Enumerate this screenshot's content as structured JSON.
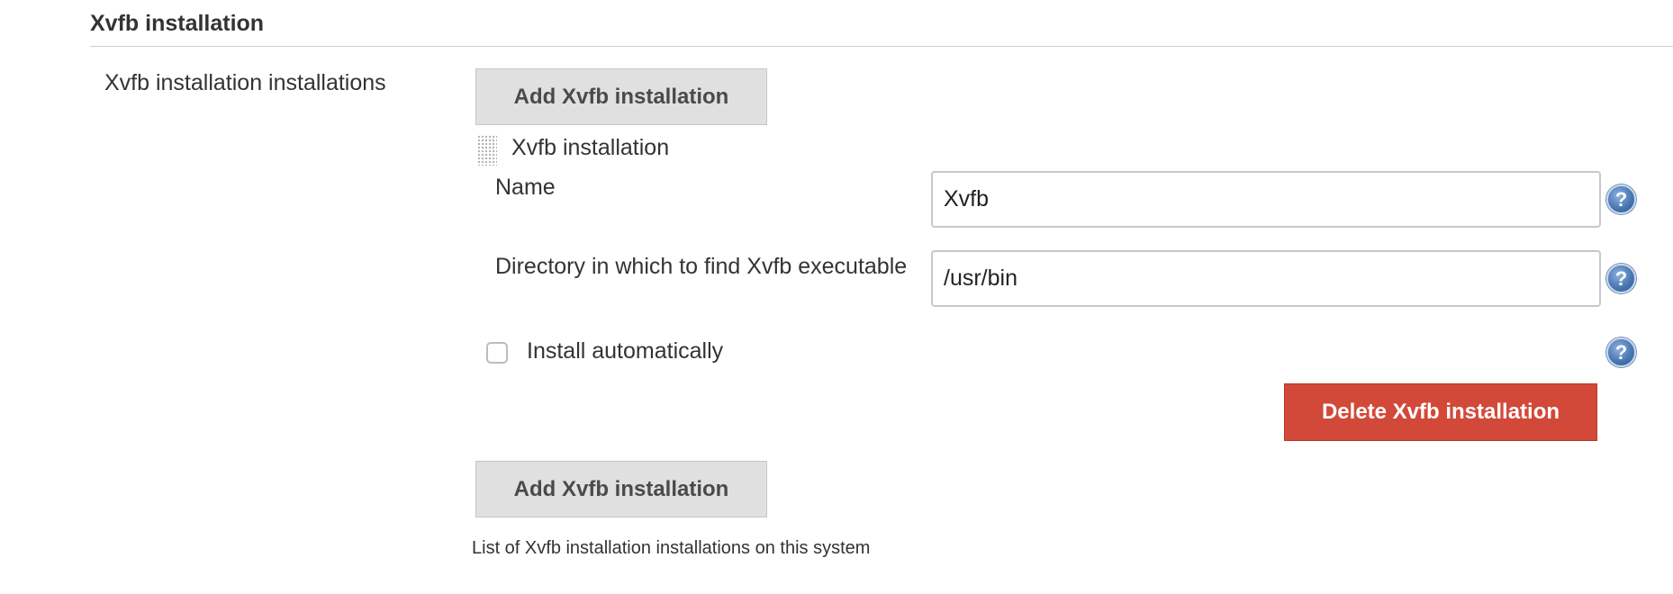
{
  "section": {
    "title": "Xvfb installation"
  },
  "installations": {
    "label": "Xvfb installation installations",
    "add_button_label": "Add Xvfb installation",
    "help_text": "List of Xvfb installation installations on this system",
    "items": [
      {
        "title": "Xvfb installation",
        "name_label": "Name",
        "name_value": "Xvfb",
        "directory_label": "Directory in which to find Xvfb executable",
        "directory_value": "/usr/bin",
        "install_automatically_label": "Install automatically",
        "install_automatically_checked": false,
        "delete_button_label": "Delete Xvfb installation"
      }
    ]
  },
  "icons": {
    "help": "help-icon",
    "drag_handle": "drag-handle-icon",
    "help_glyph": "?"
  },
  "colors": {
    "delete_button": "#d24939",
    "add_button": "#e0e0e0",
    "help_icon": "#4a78b4"
  }
}
